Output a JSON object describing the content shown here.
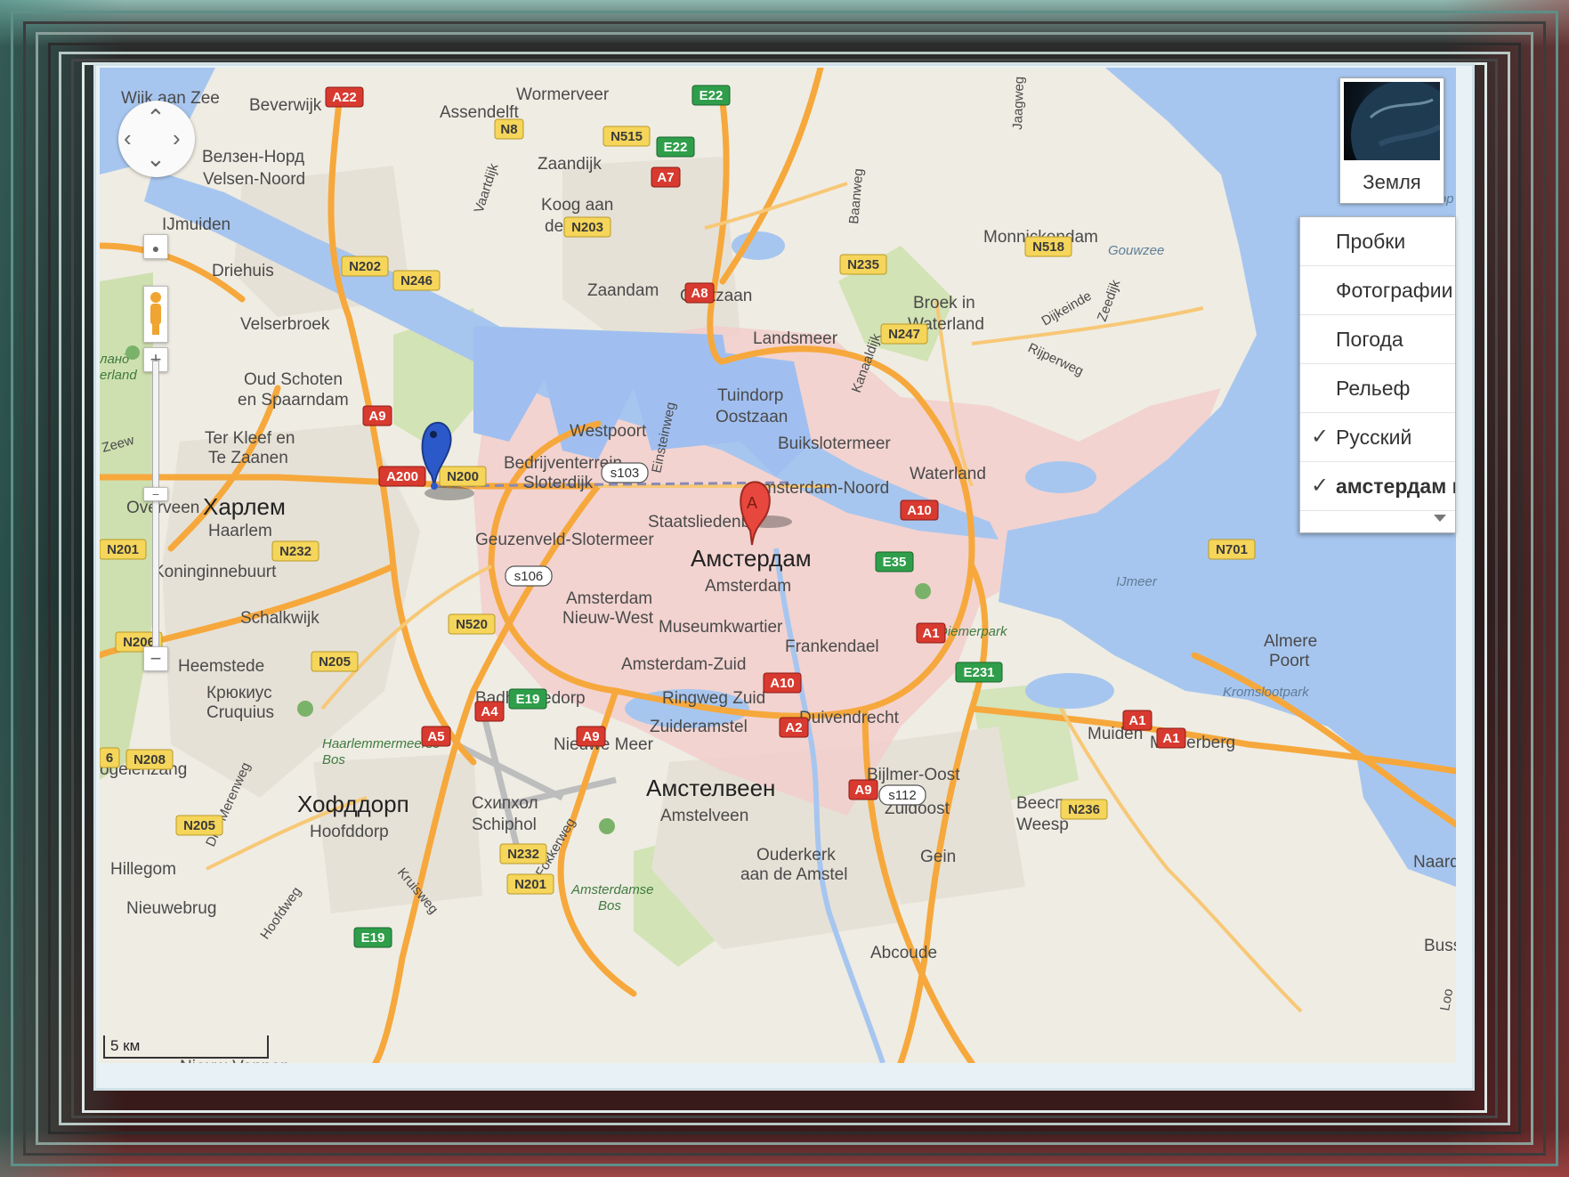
{
  "map": {
    "towns": [
      {
        "id": "wijk-aan-zee",
        "name": "Wijk aan Zee"
      },
      {
        "id": "beverwijk",
        "name": "Beverwijk"
      },
      {
        "id": "wormerveer",
        "name": "Wormerveer"
      },
      {
        "id": "assendelft",
        "name": "Assendelft"
      },
      {
        "id": "velsen-ru",
        "name": "Велзен-Норд"
      },
      {
        "id": "velsen-noord",
        "name": "Velsen-Noord"
      },
      {
        "id": "zaandijk",
        "name": "Zaandijk"
      },
      {
        "id": "koog",
        "name": "Koog aan"
      },
      {
        "id": "de-zaan",
        "name": "de Zaan"
      },
      {
        "id": "ijmuiden",
        "name": "IJmuiden"
      },
      {
        "id": "driehuis",
        "name": "Driehuis"
      },
      {
        "id": "zaandam",
        "name": "Zaandam"
      },
      {
        "id": "oostzaan",
        "name": "Oostzaan"
      },
      {
        "id": "monnickendam",
        "name": "Monnickendam"
      },
      {
        "id": "gouwzee",
        "name": "Gouwzee"
      },
      {
        "id": "broek",
        "name": "Broek in"
      },
      {
        "id": "waterland-top",
        "name": "Waterland"
      },
      {
        "id": "landsmeer",
        "name": "Landsmeer"
      },
      {
        "id": "velserbroek",
        "name": "Velserbroek"
      },
      {
        "id": "oud-schoten",
        "name": "Oud Schoten"
      },
      {
        "id": "spaarndam",
        "name": "en Spaarndam"
      },
      {
        "id": "tuindorp",
        "name": "Tuindorp"
      },
      {
        "id": "oostzaan2",
        "name": "Oostzaan"
      },
      {
        "id": "westpoort",
        "name": "Westpoort"
      },
      {
        "id": "buikslotermeer",
        "name": "Buikslotermeer"
      },
      {
        "id": "ter-kleef",
        "name": "Ter Kleef en"
      },
      {
        "id": "te-zaanen",
        "name": "Te Zaanen"
      },
      {
        "id": "bedrijven",
        "name": "Bedrijventerrein"
      },
      {
        "id": "sloterdijk",
        "name": "Sloterdijk"
      },
      {
        "id": "waterland",
        "name": "Waterland"
      },
      {
        "id": "ams-noord",
        "name": "Amsterdam-Noord"
      },
      {
        "id": "overveen",
        "name": "Overveen"
      },
      {
        "id": "haarlem-ru",
        "name": "Харлем"
      },
      {
        "id": "haarlem",
        "name": "Haarlem"
      },
      {
        "id": "staatslieden",
        "name": "Staatsliedenb"
      },
      {
        "id": "geuzenveld",
        "name": "Geuzenveld-Slotermeer"
      },
      {
        "id": "ams-ru",
        "name": "Амстердам"
      },
      {
        "id": "ams",
        "name": "Amsterdam"
      },
      {
        "id": "koninginne",
        "name": "Koninginnebuurt"
      },
      {
        "id": "ijmeer",
        "name": "IJmeer"
      },
      {
        "id": "schalkwijk",
        "name": "Schalkwijk"
      },
      {
        "id": "ams-nw1",
        "name": "Amsterdam"
      },
      {
        "id": "ams-nw2",
        "name": "Nieuw-West"
      },
      {
        "id": "museum",
        "name": "Museumkwartier"
      },
      {
        "id": "diemerpark",
        "name": "Diemerpark"
      },
      {
        "id": "almere",
        "name": "Almere"
      },
      {
        "id": "poort",
        "name": "Poort"
      },
      {
        "id": "frankendael",
        "name": "Frankendael"
      },
      {
        "id": "heemstede",
        "name": "Heemstede"
      },
      {
        "id": "ams-zuid",
        "name": "Amsterdam-Zuid"
      },
      {
        "id": "kromslootpark",
        "name": "Kromslootpark"
      },
      {
        "id": "cruquius-ru",
        "name": "Крюкиус"
      },
      {
        "id": "cruquius",
        "name": "Cruquius"
      },
      {
        "id": "badhoevedorp",
        "name": "Badhoevedorp"
      },
      {
        "id": "ringweg",
        "name": "Ringweg Zuid"
      },
      {
        "id": "duivendrecht",
        "name": "Duivendrecht"
      },
      {
        "id": "zuideramstel",
        "name": "Zuideramstel"
      },
      {
        "id": "haarlemmermeerse",
        "name": "Haarlemmermeerse"
      },
      {
        "id": "bos1",
        "name": "Bos"
      },
      {
        "id": "muiden",
        "name": "Muiden"
      },
      {
        "id": "muiderberg",
        "name": "Muiderberg"
      },
      {
        "id": "nieuwe-meer",
        "name": "Nieuwe Meer"
      },
      {
        "id": "bijlmer",
        "name": "Bijlmer-Oost"
      },
      {
        "id": "ogelenzang",
        "name": "ogelenzang"
      },
      {
        "id": "amstelveen-ru",
        "name": "Амстелвеен"
      },
      {
        "id": "amstelveen",
        "name": "Amstelveen"
      },
      {
        "id": "zuidoost",
        "name": "Zuidoost"
      },
      {
        "id": "weesp-ru",
        "name": "Веесп"
      },
      {
        "id": "weesp",
        "name": "Weesp"
      },
      {
        "id": "hoofddorp-ru",
        "name": "Хофддорп"
      },
      {
        "id": "hoofddorp",
        "name": "Hoofddorp"
      },
      {
        "id": "schiphol-ru",
        "name": "Схипхол"
      },
      {
        "id": "schiphol",
        "name": "Schiphol"
      },
      {
        "id": "drie-merenweg",
        "name": "Drie Merenweg"
      },
      {
        "id": "hillegom",
        "name": "Hillegom"
      },
      {
        "id": "fokkerweg",
        "name": "Fokkerweg"
      },
      {
        "id": "ouderkerk",
        "name": "Ouderkerk"
      },
      {
        "id": "aan-de-amstel",
        "name": "aan de Amstel"
      },
      {
        "id": "gein",
        "name": "Gein"
      },
      {
        "id": "naarde",
        "name": "Naarde"
      },
      {
        "id": "kruisweg",
        "name": "Kruisweg"
      },
      {
        "id": "amsterdamse",
        "name": "Amsterdamse"
      },
      {
        "id": "bos2",
        "name": "Bos"
      },
      {
        "id": "nieuwebrug",
        "name": "Nieuwebrug"
      },
      {
        "id": "hoofdweg",
        "name": "Hoofdweg"
      },
      {
        "id": "abcoude",
        "name": "Abcoude"
      },
      {
        "id": "bussu",
        "name": "Bussu"
      },
      {
        "id": "vaartdijk",
        "name": "Vaartdijk"
      },
      {
        "id": "jaagweg",
        "name": "Jaagweg"
      },
      {
        "id": "dijkeinde",
        "name": "Dijkeinde"
      },
      {
        "id": "zeedijk",
        "name": "Zeedijk"
      },
      {
        "id": "rijperweg",
        "name": "Rijperweg"
      },
      {
        "id": "einsteinweg",
        "name": "Einsteinweg"
      },
      {
        "id": "kanaaldijk",
        "name": "Kanaaldijk"
      },
      {
        "id": "baanweg",
        "name": "Baanweg"
      },
      {
        "id": "eland",
        "name": "ланд"
      },
      {
        "id": "erland",
        "name": "erland"
      },
      {
        "id": "zeew",
        "name": "Zeew"
      },
      {
        "id": "nieuw-vennep",
        "name": "Nieuw-Vennep"
      },
      {
        "id": "loo",
        "name": "Loo"
      },
      {
        "id": "corp",
        "name": "Cop"
      }
    ],
    "shields": [
      {
        "id": "A22",
        "label": "A22",
        "kind": "a"
      },
      {
        "id": "E22a",
        "label": "E22",
        "kind": "e"
      },
      {
        "id": "N8",
        "label": "N8",
        "kind": "n"
      },
      {
        "id": "N515",
        "label": "N515",
        "kind": "n"
      },
      {
        "id": "E22b",
        "label": "E22",
        "kind": "e"
      },
      {
        "id": "A7",
        "label": "A7",
        "kind": "a"
      },
      {
        "id": "N203",
        "label": "N203",
        "kind": "n"
      },
      {
        "id": "N518",
        "label": "N518",
        "kind": "n"
      },
      {
        "id": "N202",
        "label": "N202",
        "kind": "n"
      },
      {
        "id": "N246",
        "label": "N246",
        "kind": "n"
      },
      {
        "id": "N235",
        "label": "N235",
        "kind": "n"
      },
      {
        "id": "A8",
        "label": "A8",
        "kind": "a"
      },
      {
        "id": "N247",
        "label": "N247",
        "kind": "n"
      },
      {
        "id": "A9a",
        "label": "A9",
        "kind": "a"
      },
      {
        "id": "A200",
        "label": "A200",
        "kind": "a"
      },
      {
        "id": "N200",
        "label": "N200",
        "kind": "n"
      },
      {
        "id": "s103",
        "label": "s103",
        "kind": "s"
      },
      {
        "id": "A10a",
        "label": "A10",
        "kind": "a"
      },
      {
        "id": "N201a",
        "label": "N201",
        "kind": "n"
      },
      {
        "id": "N232a",
        "label": "N232",
        "kind": "n"
      },
      {
        "id": "s106",
        "label": "s106",
        "kind": "s"
      },
      {
        "id": "E35",
        "label": "E35",
        "kind": "e"
      },
      {
        "id": "N701",
        "label": "N701",
        "kind": "n"
      },
      {
        "id": "N520",
        "label": "N520",
        "kind": "n"
      },
      {
        "id": "A1a",
        "label": "A1",
        "kind": "a"
      },
      {
        "id": "N206",
        "label": "N206",
        "kind": "n"
      },
      {
        "id": "N205a",
        "label": "N205",
        "kind": "n"
      },
      {
        "id": "A10b",
        "label": "A10",
        "kind": "a"
      },
      {
        "id": "E231",
        "label": "E231",
        "kind": "e"
      },
      {
        "id": "A4",
        "label": "A4",
        "kind": "a"
      },
      {
        "id": "E19a",
        "label": "E19",
        "kind": "e"
      },
      {
        "id": "A2",
        "label": "A2",
        "kind": "a"
      },
      {
        "id": "A1b",
        "label": "A1",
        "kind": "a"
      },
      {
        "id": "A1c",
        "label": "A1",
        "kind": "a"
      },
      {
        "id": "A5",
        "label": "A5",
        "kind": "a"
      },
      {
        "id": "A9b",
        "label": "A9",
        "kind": "a"
      },
      {
        "id": "N208",
        "label": "N208",
        "kind": "n"
      },
      {
        "id": "A9c",
        "label": "A9",
        "kind": "a"
      },
      {
        "id": "s112",
        "label": "s112",
        "kind": "s"
      },
      {
        "id": "N236",
        "label": "N236",
        "kind": "n"
      },
      {
        "id": "N205b",
        "label": "N205",
        "kind": "n"
      },
      {
        "id": "N232b",
        "label": "N232",
        "kind": "n"
      },
      {
        "id": "N201b",
        "label": "N201",
        "kind": "n"
      },
      {
        "id": "E19b",
        "label": "E19",
        "kind": "e"
      },
      {
        "id": "six",
        "label": "6",
        "kind": "n"
      }
    ],
    "marker_a_label": "A",
    "colors": {
      "land": "#f0ede5",
      "water": "#a5c3f0",
      "urban": "#ebe5d8",
      "park": "#cbdfa9",
      "motorway": "#f4a53c",
      "route_area": "#f3c7c7",
      "marker_red": "#e8473d",
      "marker_blue": "#2c59c9"
    }
  },
  "controls": {
    "pan_icon": "pan-arrows",
    "zoom_in": "+",
    "zoom_out": "−",
    "zoom_level_fraction": 0.43,
    "pegman_icon": "pegman-icon"
  },
  "earth_toggle": {
    "label": "Земля"
  },
  "layers_menu": {
    "items": [
      {
        "label": "Пробки",
        "checked": false,
        "bold": false
      },
      {
        "label": "Фотографии",
        "checked": false,
        "bold": false
      },
      {
        "label": "Погода",
        "checked": false,
        "bold": false
      },
      {
        "label": "Рельеф",
        "checked": false,
        "bold": false
      },
      {
        "label": "Русский",
        "checked": true,
        "bold": false
      },
      {
        "label": "амстердам к",
        "checked": true,
        "bold": true
      }
    ],
    "check_glyph": "✓"
  },
  "scale_bar": {
    "label": "5 км"
  }
}
